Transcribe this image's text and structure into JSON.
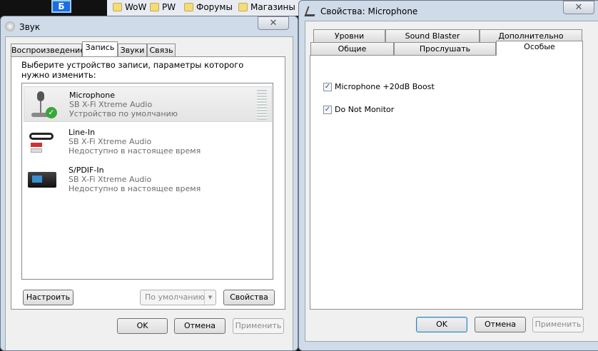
{
  "desktop": {
    "bookmarks": [
      "WoW",
      "PW",
      "Форумы",
      "Магазины"
    ],
    "app_label": "Б"
  },
  "sound": {
    "title": "Звук",
    "tabs": [
      "Воспроизведение",
      "Запись",
      "Звуки",
      "Связь"
    ],
    "active_tab": "Запись",
    "instruction": "Выберите устройство записи, параметры которого нужно изменить:",
    "devices": [
      {
        "name": "Microphone",
        "driver": "SB X-Fi Xtreme Audio",
        "status": "Устройство по умолчанию",
        "selected": true,
        "icon": "microphone-icon"
      },
      {
        "name": "Line-In",
        "driver": "SB X-Fi Xtreme Audio",
        "status": "Недоступно в настоящее время",
        "icon": "line-in-cable-icon"
      },
      {
        "name": "S/PDIF-In",
        "driver": "SB X-Fi Xtreme Audio",
        "status": "Недоступно в настоящее время",
        "icon": "spdif-device-icon"
      }
    ],
    "configure": "Настроить",
    "set_default": "По умолчанию",
    "properties": "Свойства",
    "ok": "OK",
    "cancel": "Отмена",
    "apply": "Применить"
  },
  "props": {
    "title": "Свойства: Microphone",
    "tabs_row1": [
      "Уровни",
      "Sound Blaster",
      "Дополнительно"
    ],
    "tabs_row2": [
      "Общие",
      "Прослушать",
      "Особые"
    ],
    "active_tab": "Особые",
    "options": [
      {
        "label": "Microphone +20dB Boost",
        "checked": true
      },
      {
        "label": "Do Not Monitor",
        "checked": true
      }
    ],
    "ok": "OK",
    "cancel": "Отмена",
    "apply": "Применить"
  }
}
